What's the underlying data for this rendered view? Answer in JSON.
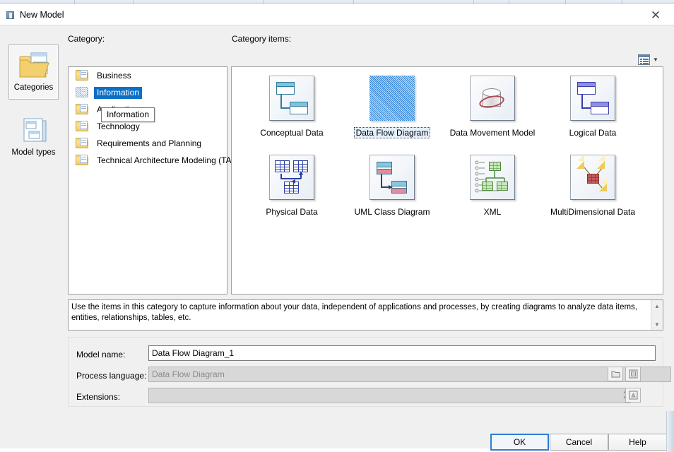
{
  "window": {
    "title": "New Model",
    "close_label": "✕",
    "title_icon": "window-icon"
  },
  "sidebar": {
    "items": [
      {
        "label": "Categories",
        "icon": "folder-pages-icon",
        "selected": true
      },
      {
        "label": "Model types",
        "icon": "stacked-pages-icon",
        "selected": false
      }
    ]
  },
  "labels": {
    "category": "Category:",
    "category_items": "Category items:",
    "model_name": "Model name:",
    "process_language": "Process language:",
    "extensions": "Extensions:"
  },
  "categories": {
    "items": [
      {
        "label": "Business",
        "selected": false
      },
      {
        "label": "Information",
        "selected": true
      },
      {
        "label": "Application",
        "selected": false
      },
      {
        "label": "Technology",
        "selected": false
      },
      {
        "label": "Requirements and Planning",
        "selected": false
      },
      {
        "label": "Technical Architecture Modeling (TAM)",
        "selected": false
      }
    ]
  },
  "tooltip": {
    "text": "Information"
  },
  "category_items": {
    "items": [
      {
        "label": "Conceptual Data",
        "icon": "conceptual-data-icon",
        "selected": false
      },
      {
        "label": "Data Flow Diagram",
        "icon": "data-flow-diagram-icon",
        "selected": true
      },
      {
        "label": "Data Movement Model",
        "icon": "data-movement-model-icon",
        "selected": false
      },
      {
        "label": "Logical Data",
        "icon": "logical-data-icon",
        "selected": false
      },
      {
        "label": "Physical Data",
        "icon": "physical-data-icon",
        "selected": false
      },
      {
        "label": "UML Class Diagram",
        "icon": "uml-class-diagram-icon",
        "selected": false
      },
      {
        "label": "XML",
        "icon": "xml-icon",
        "selected": false
      },
      {
        "label": "MultiDimensional Data",
        "icon": "multidimensional-data-icon",
        "selected": false
      }
    ]
  },
  "description": {
    "text": "Use the items in this category to capture information about your data, independent of applications and processes, by creating diagrams to analyze data items, entities, relationships, tables, etc.",
    "scroll_up": "▲",
    "scroll_down": "▼"
  },
  "form": {
    "model_name_value": "Data Flow Diagram_1",
    "model_name_placeholder": "",
    "process_language_value": "Data Flow Diagram",
    "process_language_enabled": false,
    "extensions_value": "",
    "extensions_placeholder": "",
    "buttons": {
      "browse_language": "folder-open-icon",
      "language_properties": "page-properties-icon",
      "extensions_properties": "extension-properties-icon"
    }
  },
  "view_toggle": {
    "label": "view-mode",
    "icon": "list-view-icon",
    "chevron": "▼"
  },
  "footer": {
    "ok": "OK",
    "cancel": "Cancel",
    "help": "Help"
  },
  "colors": {
    "selection_blue": "#0b6fc6",
    "focus_blue": "#2b7fd4",
    "dialog_bg": "#f0f0f0",
    "panel_bg": "#ffffff",
    "disabled_bg": "#d8d8d8"
  }
}
